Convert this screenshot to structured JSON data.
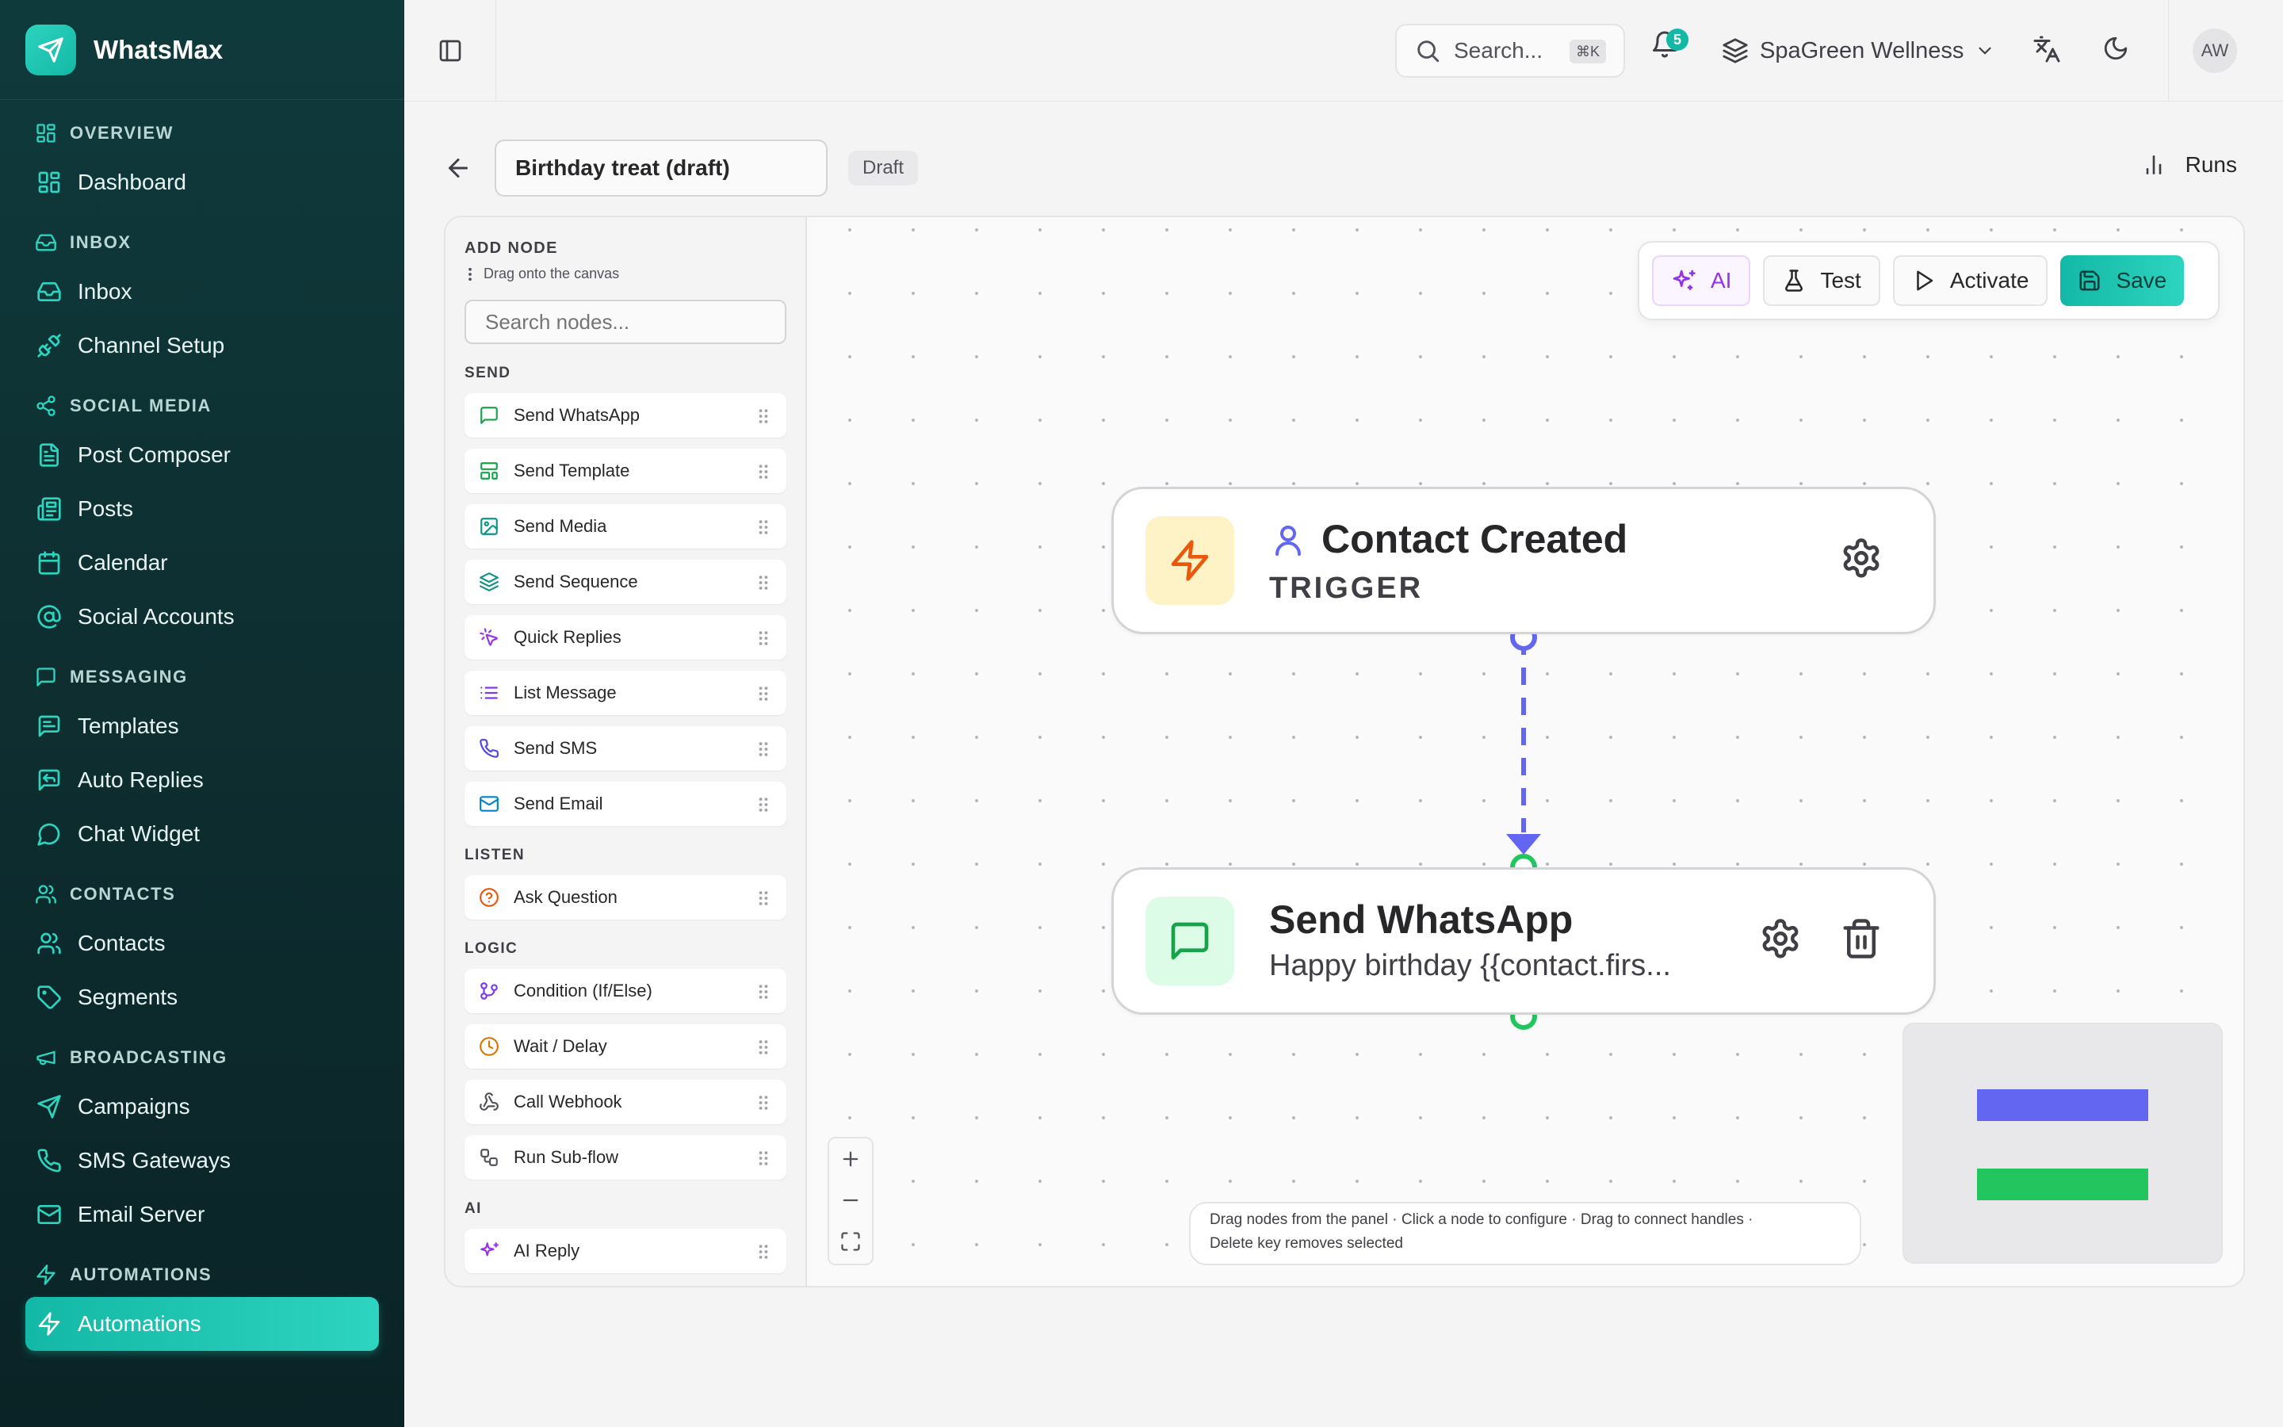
{
  "app": {
    "name": "WhatsMax"
  },
  "sidebar": {
    "sections": [
      {
        "title": "OVERVIEW",
        "icon": "grid-icon",
        "items": [
          {
            "label": "Dashboard",
            "icon": "grid-icon"
          }
        ]
      },
      {
        "title": "INBOX",
        "icon": "inbox-icon",
        "items": [
          {
            "label": "Inbox",
            "icon": "inbox-icon"
          },
          {
            "label": "Channel Setup",
            "icon": "plug-icon"
          }
        ]
      },
      {
        "title": "SOCIAL MEDIA",
        "icon": "share-icon",
        "items": [
          {
            "label": "Post Composer",
            "icon": "file-icon"
          },
          {
            "label": "Posts",
            "icon": "newspaper-icon"
          },
          {
            "label": "Calendar",
            "icon": "calendar-icon"
          },
          {
            "label": "Social Accounts",
            "icon": "at-icon"
          }
        ]
      },
      {
        "title": "MESSAGING",
        "icon": "message-icon",
        "items": [
          {
            "label": "Templates",
            "icon": "message-text-icon"
          },
          {
            "label": "Auto Replies",
            "icon": "reply-icon"
          },
          {
            "label": "Chat Widget",
            "icon": "chat-circle-icon"
          }
        ]
      },
      {
        "title": "CONTACTS",
        "icon": "users-icon",
        "items": [
          {
            "label": "Contacts",
            "icon": "users-icon"
          },
          {
            "label": "Segments",
            "icon": "tag-icon"
          }
        ]
      },
      {
        "title": "BROADCASTING",
        "icon": "megaphone-icon",
        "items": [
          {
            "label": "Campaigns",
            "icon": "send-icon"
          },
          {
            "label": "SMS Gateways",
            "icon": "phone-icon"
          },
          {
            "label": "Email Server",
            "icon": "mail-icon"
          }
        ]
      },
      {
        "title": "AUTOMATIONS",
        "icon": "zap-icon",
        "items": [
          {
            "label": "Automations",
            "icon": "zap-icon",
            "active": true
          }
        ]
      }
    ]
  },
  "topbar": {
    "search_label": "Search...",
    "search_shortcut": "⌘K",
    "notification_count": "5",
    "workspace": "SpaGreen Wellness",
    "avatar_initials": "AW"
  },
  "flow": {
    "name": "Birthday treat (draft)",
    "status": "Draft",
    "runs_label": "Runs"
  },
  "panel": {
    "title": "ADD NODE",
    "subtitle": "Drag onto the canvas",
    "search_placeholder": "Search nodes...",
    "groups": [
      {
        "name": "SEND",
        "items": [
          {
            "label": "Send WhatsApp",
            "icon": "message-square-icon",
            "color": "#16a34a"
          },
          {
            "label": "Send Template",
            "icon": "layout-template-icon",
            "color": "#16a34a"
          },
          {
            "label": "Send Media",
            "icon": "image-icon",
            "color": "#0d9488"
          },
          {
            "label": "Send Sequence",
            "icon": "layers-icon",
            "color": "#0d9488"
          },
          {
            "label": "Quick Replies",
            "icon": "pointer-click-icon",
            "color": "#9333ea"
          },
          {
            "label": "List Message",
            "icon": "list-icon",
            "color": "#7c3aed"
          },
          {
            "label": "Send SMS",
            "icon": "phone-icon",
            "color": "#4f46e5"
          },
          {
            "label": "Send Email",
            "icon": "mail-icon",
            "color": "#0284c7"
          }
        ]
      },
      {
        "name": "LISTEN",
        "items": [
          {
            "label": "Ask Question",
            "icon": "help-circle-icon",
            "color": "#ea580c"
          }
        ]
      },
      {
        "name": "LOGIC",
        "items": [
          {
            "label": "Condition (If/Else)",
            "icon": "git-branch-icon",
            "color": "#7c3aed"
          },
          {
            "label": "Wait / Delay",
            "icon": "clock-icon",
            "color": "#d97706"
          },
          {
            "label": "Call Webhook",
            "icon": "webhook-icon",
            "color": "#52525b"
          },
          {
            "label": "Run Sub-flow",
            "icon": "workflow-icon",
            "color": "#52525b"
          }
        ]
      },
      {
        "name": "AI",
        "items": [
          {
            "label": "AI Reply",
            "icon": "sparkles-icon",
            "color": "#9333ea"
          }
        ]
      }
    ]
  },
  "toolbar": {
    "ai": "AI",
    "test": "Test",
    "activate": "Activate",
    "save": "Save"
  },
  "nodes": {
    "trigger": {
      "title": "Contact Created",
      "subtitle": "TRIGGER"
    },
    "action": {
      "title": "Send WhatsApp",
      "subtitle": "Happy birthday {{contact.firs..."
    }
  },
  "hint": {
    "line1": "Drag nodes from the panel · Click a node to configure · Drag to connect handles ·",
    "line2": "Delete key removes selected"
  },
  "colors": {
    "accent": "#14b8a6",
    "edge": "#6366f1",
    "handle_out": "#22c55e"
  }
}
